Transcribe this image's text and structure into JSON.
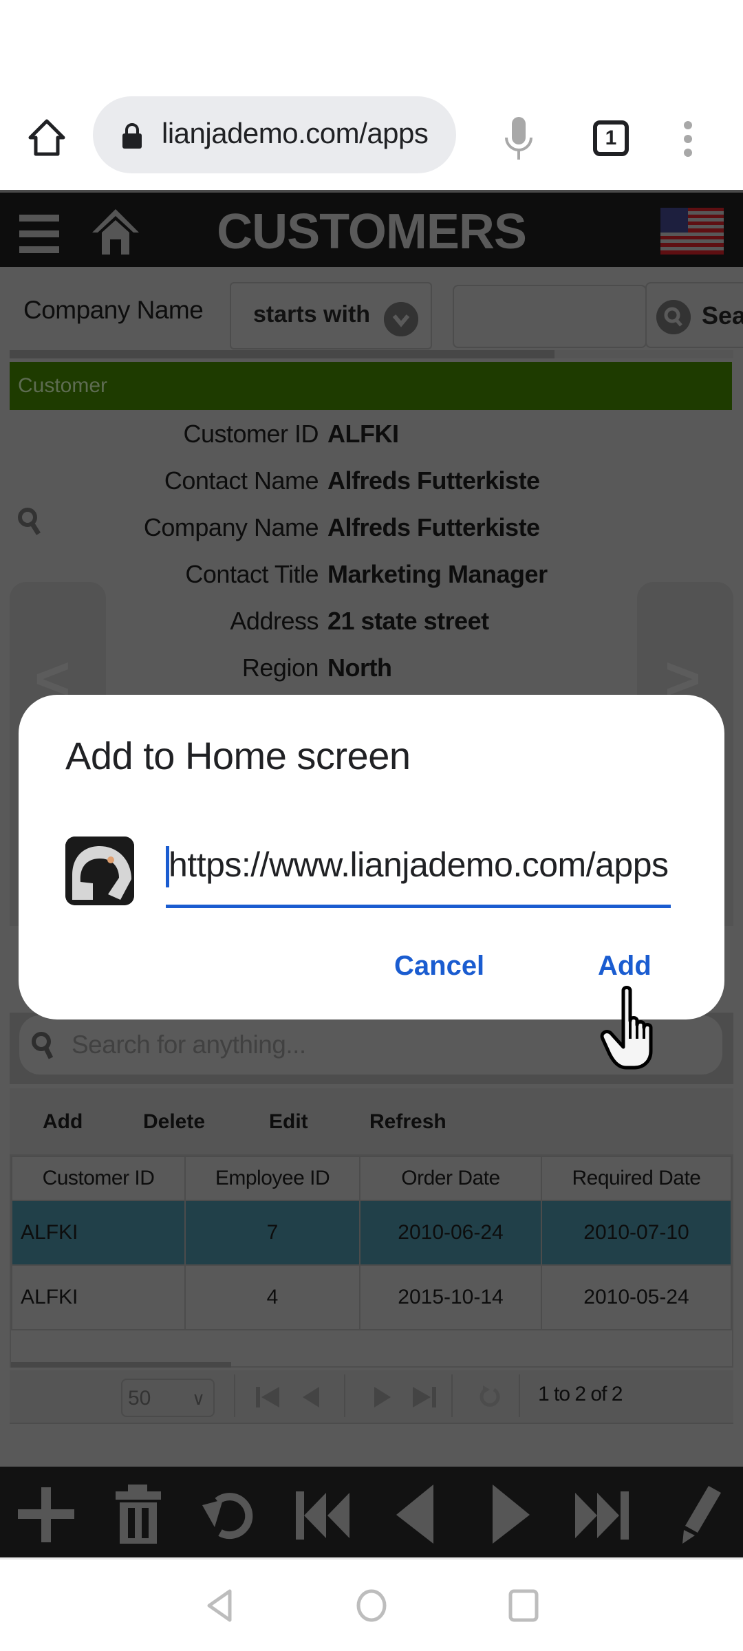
{
  "browser": {
    "url_display": "lianjademo.com/apps",
    "tab_count": "1"
  },
  "app": {
    "title": "CUSTOMERS",
    "filter": {
      "field_label": "Company Name",
      "operator": "starts with",
      "value": "",
      "search_label": "Search"
    },
    "section_title": "Customer",
    "form_fields": [
      {
        "label": "Customer ID",
        "value": "ALFKI"
      },
      {
        "label": "Contact Name",
        "value": "Alfreds Futterkiste"
      },
      {
        "label": "Company Name",
        "value": "Alfreds Futterkiste"
      },
      {
        "label": "Contact Title",
        "value": "Marketing Manager"
      },
      {
        "label": "Address",
        "value": "21 state street"
      },
      {
        "label": "Region",
        "value": "North"
      }
    ],
    "prev_label": "<",
    "next_label": ">",
    "search_placeholder": "Search for anything...",
    "toolbar": {
      "add": "Add",
      "delete": "Delete",
      "edit": "Edit",
      "refresh": "Refresh"
    },
    "grid": {
      "columns": [
        "Customer ID",
        "Employee ID",
        "Order Date",
        "Required Date"
      ],
      "rows": [
        {
          "customer_id": "ALFKI",
          "employee_id": "7",
          "order_date": "2010-06-24",
          "required_date": "2010-07-10",
          "selected": true
        },
        {
          "customer_id": "ALFKI",
          "employee_id": "4",
          "order_date": "2015-10-14",
          "required_date": "2010-05-24",
          "selected": false
        }
      ]
    },
    "pager": {
      "page_size": "50",
      "info": "1 to 2 of 2"
    }
  },
  "dialog": {
    "title": "Add to Home screen",
    "url_value": "https://www.lianjademo.com/apps",
    "cancel_label": "Cancel",
    "add_label": "Add"
  },
  "colors": {
    "accent_blue": "#1a5cd0",
    "section_green": "#1e3b00",
    "selected_row": "#214049"
  }
}
